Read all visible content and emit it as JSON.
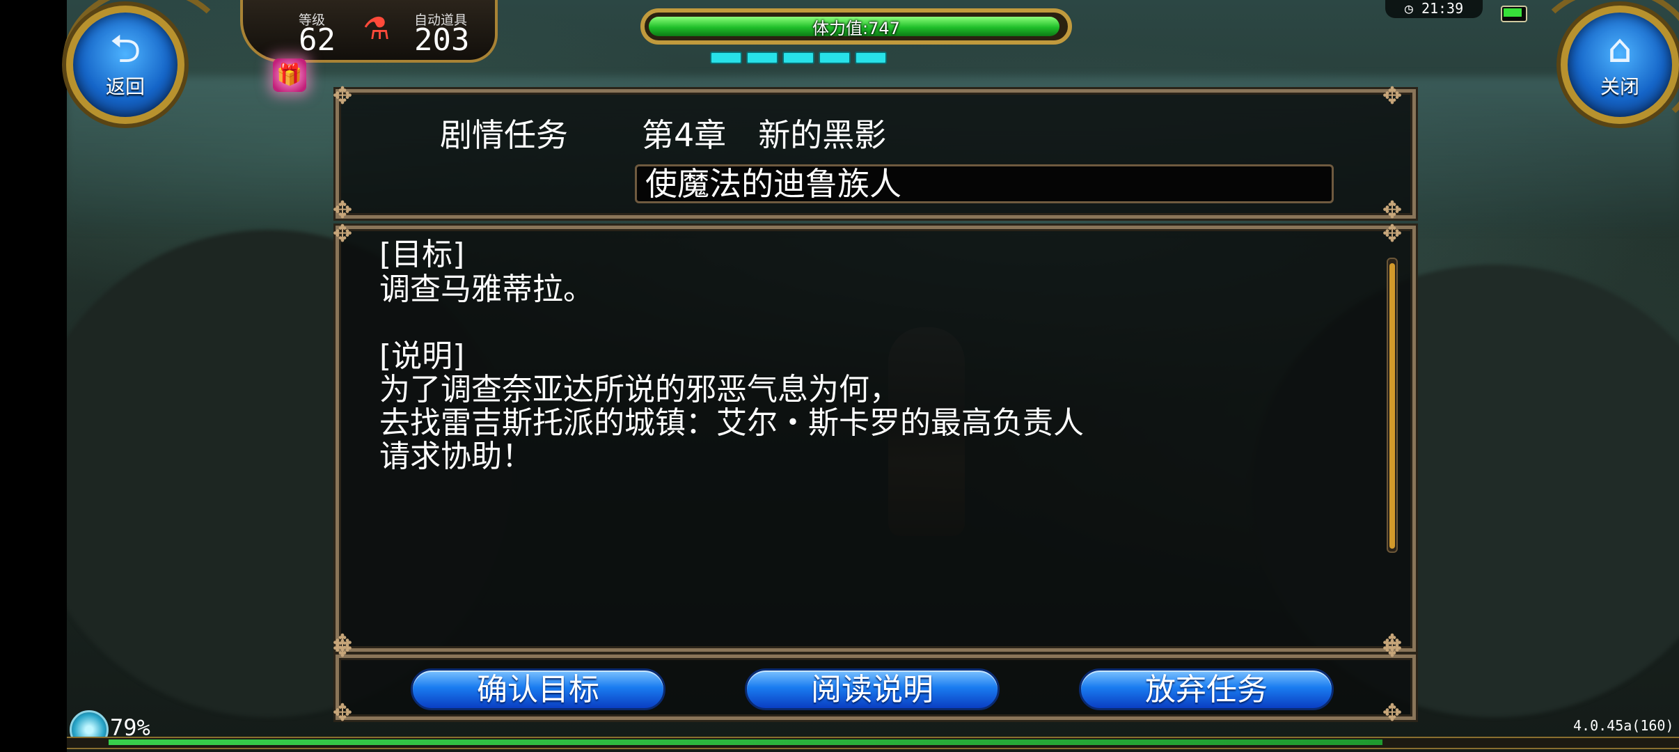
{
  "top_left": {
    "back_label": "返回",
    "level_label": "等级",
    "level_value": "62",
    "auto_item_label": "自动道具",
    "auto_item_value": "203"
  },
  "stamina": {
    "text": "体力值:747",
    "fill_fraction": 0.99,
    "pips": 5
  },
  "top_right": {
    "time": "21:39",
    "close_label": "关闭"
  },
  "quest": {
    "type": "剧情任务",
    "chapter": "第4章　新的黑影",
    "title": "使魔法的迪鲁族人",
    "objective_header": "[目标]",
    "objective_text": "调查马雅蒂拉。",
    "description_header": "[说明]",
    "description_lines": [
      "为了调查奈亚达所说的邪恶气息为何，",
      "去找雷吉斯托派的城镇：艾尔・斯卡罗的最高负责人",
      "请求协助！"
    ]
  },
  "buttons": {
    "confirm": "确认目标",
    "read": "阅读说明",
    "abandon": "放弃任务"
  },
  "bottom": {
    "exp_percent": "79%",
    "exp_fraction": 0.79,
    "version": "4.0.45a(160)"
  },
  "colors": {
    "gold": "#b8922e",
    "stamina_green": "#1fbf2a",
    "button_blue": "#1a7cf0",
    "pip_cyan": "#28e1e8"
  },
  "icons": [
    "back-arrow-icon",
    "home-icon",
    "gift-icon",
    "potion-icon",
    "exp-orb-icon",
    "clock-icon",
    "battery-icon"
  ]
}
